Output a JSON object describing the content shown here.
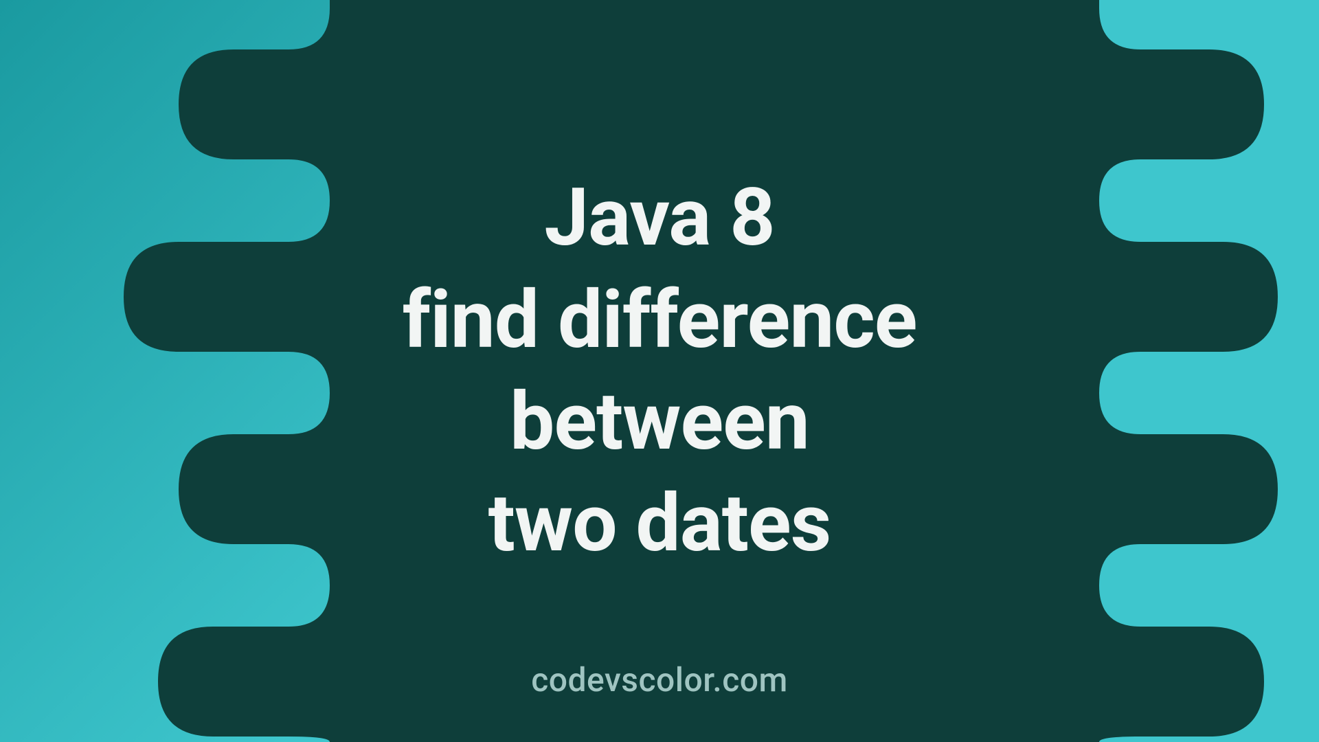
{
  "title": {
    "line1": "Java 8",
    "line2": "find difference",
    "line3": "between",
    "line4": "two dates"
  },
  "attribution": "codevscolor.com",
  "colors": {
    "bg_light": "#3ec6cd",
    "bg_dark_teal": "#1a9aa0",
    "blob": "#0e3e3a",
    "title_text": "#f2f5f4",
    "attribution_text": "#9fc4c1"
  }
}
